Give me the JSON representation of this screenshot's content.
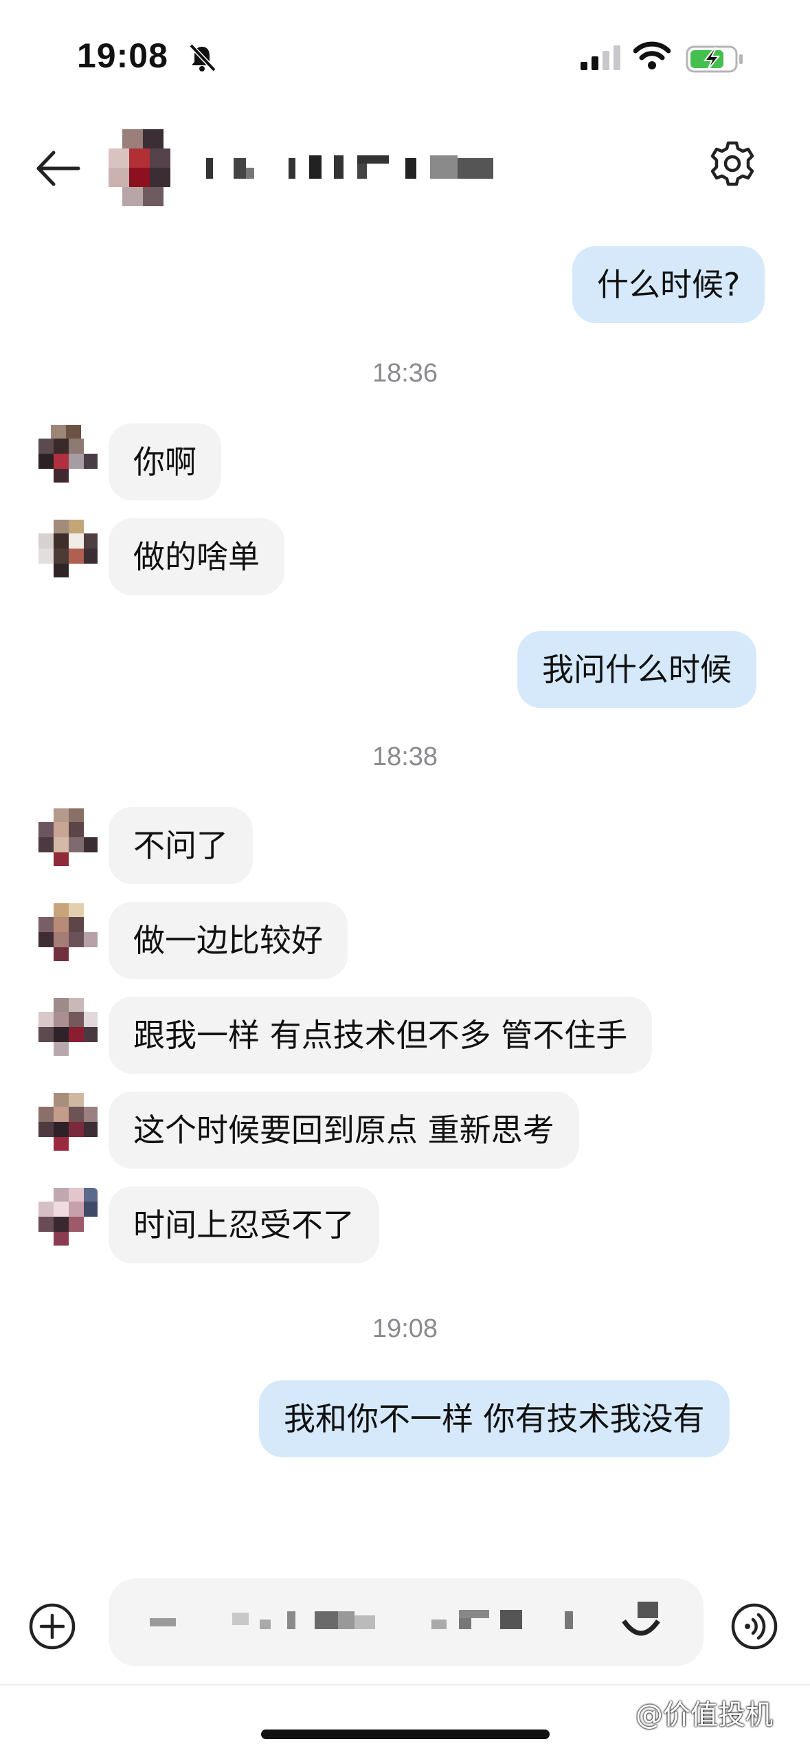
{
  "status_bar": {
    "time": "19:08"
  },
  "chat": {
    "messages": [
      {
        "text": "什么时候?"
      },
      {
        "time": "18:36"
      },
      {
        "text": "你啊"
      },
      {
        "text": "做的啥单"
      },
      {
        "text": "我问什么时候"
      },
      {
        "time": "18:38"
      },
      {
        "text": "不问了"
      },
      {
        "text": "做一边比较好"
      },
      {
        "text": "跟我一样 有点技术但不多 管不住手"
      },
      {
        "text": "这个时候要回到原点 重新思考"
      },
      {
        "text": "时间上忍受不了"
      },
      {
        "time": "19:08"
      },
      {
        "text": "我和你不一样 你有技术我没有"
      }
    ]
  },
  "watermark": "@价值投机",
  "colors": {
    "outgoing_bubble": "#d6e9fb",
    "incoming_bubble": "#f3f3f4",
    "timestamp": "#8a8a8e"
  },
  "icons": [
    "bell-muted-icon",
    "signal-icon",
    "wifi-icon",
    "battery-charging-icon",
    "back-arrow-icon",
    "gear-icon",
    "plus-circle-icon",
    "voice-icon"
  ]
}
